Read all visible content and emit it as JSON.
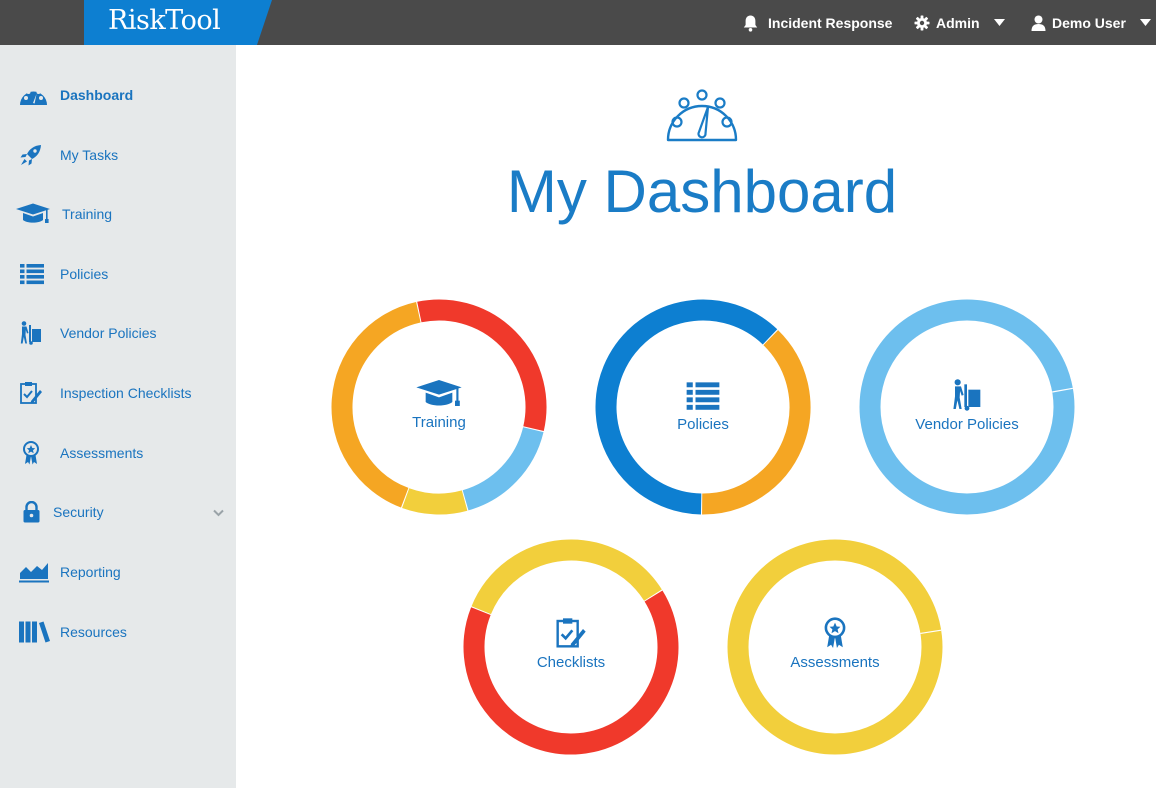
{
  "app": {
    "logo": "RiskTool"
  },
  "topbar": {
    "incident": "Incident Response",
    "admin": "Admin",
    "user": "Demo User"
  },
  "sidebar": {
    "items": [
      {
        "label": "Dashboard",
        "icon": "dashboard-icon",
        "active": true
      },
      {
        "label": "My Tasks",
        "icon": "rocket-icon"
      },
      {
        "label": "Training",
        "icon": "graduation-cap-icon"
      },
      {
        "label": "Policies",
        "icon": "list-icon"
      },
      {
        "label": "Vendor Policies",
        "icon": "hand-truck-icon"
      },
      {
        "label": "Inspection Checklists",
        "icon": "clipboard-check-icon"
      },
      {
        "label": "Assessments",
        "icon": "award-icon"
      },
      {
        "label": "Security",
        "icon": "lock-icon",
        "expandable": true
      },
      {
        "label": "Reporting",
        "icon": "area-chart-icon"
      },
      {
        "label": "Resources",
        "icon": "books-icon"
      }
    ]
  },
  "main": {
    "title": "My Dashboard",
    "rings": [
      {
        "label": "Training",
        "icon": "graduation-cap-icon",
        "segments": [
          {
            "color": "#f0392b",
            "fraction": 0.32
          },
          {
            "color": "#6dbfee",
            "fraction": 0.17
          },
          {
            "color": "#f2cf3c",
            "fraction": 0.1
          },
          {
            "color": "#f5a623",
            "fraction": 0.41
          }
        ]
      },
      {
        "label": "Policies",
        "icon": "list-icon",
        "segments": [
          {
            "color": "#f5a623",
            "fraction": 0.38
          },
          {
            "color": "#0d7fd1",
            "fraction": 0.62
          }
        ]
      },
      {
        "label": "Vendor Policies",
        "icon": "hand-truck-icon",
        "segments": [
          {
            "color": "#6dbfee",
            "fraction": 1.0
          }
        ]
      },
      {
        "label": "Checklists",
        "icon": "clipboard-check-icon",
        "segments": [
          {
            "color": "#f0392b",
            "fraction": 0.65
          },
          {
            "color": "#f2cf3c",
            "fraction": 0.35
          }
        ]
      },
      {
        "label": "Assessments",
        "icon": "award-icon",
        "segments": [
          {
            "color": "#f2cf3c",
            "fraction": 1.0
          }
        ]
      }
    ]
  },
  "colors": {
    "brand": "#0d7fd1",
    "topbar": "#4a4a4a",
    "sidebar": "#e6e9ea",
    "link": "#1a74bf"
  }
}
